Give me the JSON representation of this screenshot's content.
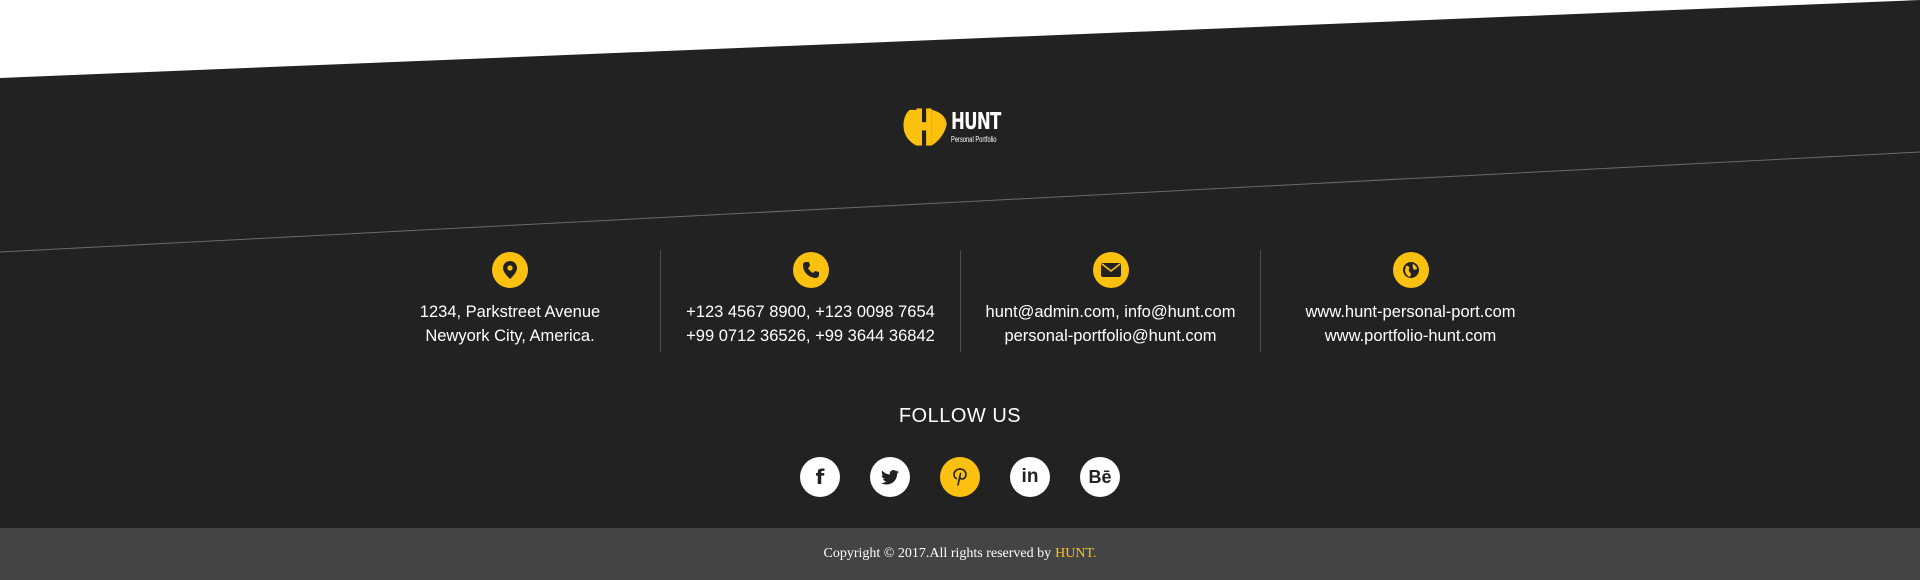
{
  "logo": {
    "name": "HUNT",
    "tagline": "Personal Portfolio"
  },
  "contacts": [
    {
      "icon": "location-pin-icon",
      "lines": [
        "1234, Parkstreet Avenue",
        "Newyork City, America."
      ]
    },
    {
      "icon": "phone-icon",
      "lines": [
        "+123 4567 8900, +123 0098 7654",
        "+99 0712 36526, +99 3644 36842"
      ]
    },
    {
      "icon": "envelope-icon",
      "lines": [
        "hunt@admin.com, info@hunt.com",
        "personal-portfolio@hunt.com"
      ]
    },
    {
      "icon": "globe-icon",
      "lines": [
        "www.hunt-personal-port.com",
        "www.portfolio-hunt.com"
      ]
    }
  ],
  "follow": {
    "title": "FOLLOW US",
    "socials": [
      {
        "name": "facebook-icon",
        "glyph": "f",
        "active": false
      },
      {
        "name": "twitter-icon",
        "glyph": "",
        "active": false
      },
      {
        "name": "pinterest-icon",
        "glyph": "",
        "active": true
      },
      {
        "name": "linkedin-icon",
        "glyph": "in",
        "active": false
      },
      {
        "name": "behance-icon",
        "glyph": "Bē",
        "active": false
      }
    ]
  },
  "copyright": {
    "text": "Copyright © 2017.All rights reserved by",
    "brand": "HUNT."
  },
  "colors": {
    "background": "#222222",
    "accent": "#fcc10e",
    "bottom_bar": "#444444",
    "text": "#ffffff"
  }
}
